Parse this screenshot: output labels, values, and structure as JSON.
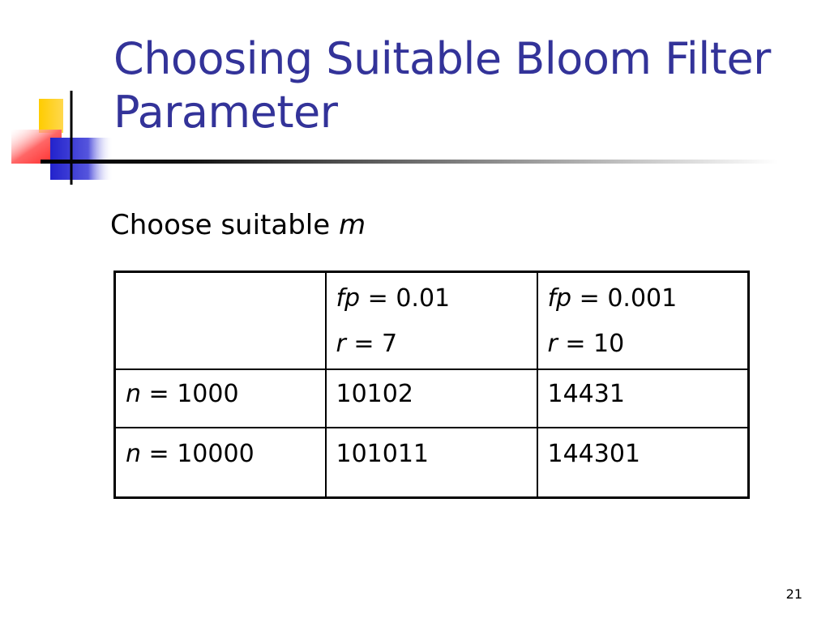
{
  "slide": {
    "title_line1": "Choosing Suitable Bloom Filter",
    "title_line2": "Parameter",
    "subtitle_text": "Choose suitable ",
    "subtitle_var": "m",
    "page_number": "21",
    "colors": {
      "title": "#333399",
      "deco_yellow": "#FFCC00",
      "deco_red": "#FF3333",
      "deco_blue": "#3333CC"
    }
  },
  "table": {
    "header": {
      "col2": {
        "line1_var": "fp",
        "line1_rest": " = 0.01",
        "line2_var": "r",
        "line2_rest": " = 7"
      },
      "col3": {
        "line1_var": "fp",
        "line1_rest": " = 0.001",
        "line2_var": "r",
        "line2_rest": " = 10"
      }
    },
    "rows": [
      {
        "label_var": "n",
        "label_rest": " = 1000",
        "v1": "10102",
        "v2": "14431"
      },
      {
        "label_var": "n",
        "label_rest": " = 10000",
        "v1": "101011",
        "v2": "144301"
      }
    ]
  }
}
